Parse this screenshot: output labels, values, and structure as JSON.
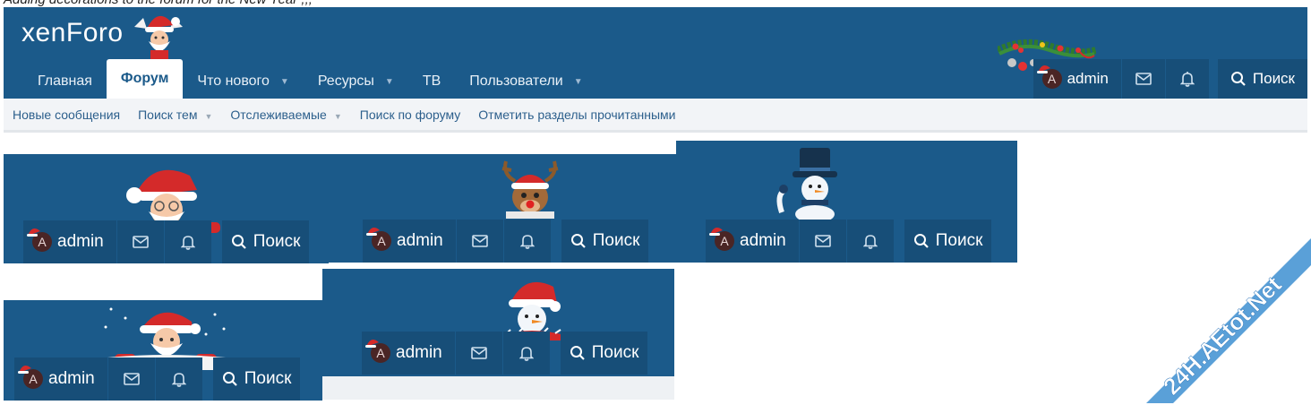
{
  "caption": "Adding decorations to the forum for the New Year ;;;",
  "logo": {
    "text": "xenForo"
  },
  "nav": {
    "tabs": [
      {
        "label": "Главная",
        "active": false,
        "dropdown": false
      },
      {
        "label": "Форум",
        "active": true,
        "dropdown": false
      },
      {
        "label": "Что нового",
        "active": false,
        "dropdown": true
      },
      {
        "label": "Ресурсы",
        "active": false,
        "dropdown": true
      },
      {
        "label": "ТВ",
        "active": false,
        "dropdown": false
      },
      {
        "label": "Пользователи",
        "active": false,
        "dropdown": true
      }
    ]
  },
  "user": {
    "name": "admin",
    "avatar_letter": "A",
    "search_label": "Поиск"
  },
  "subnav": {
    "items": [
      {
        "label": "Новые сообщения",
        "dropdown": false
      },
      {
        "label": "Поиск тем",
        "dropdown": true
      },
      {
        "label": "Отслеживаемые",
        "dropdown": true
      },
      {
        "label": "Поиск по форуму",
        "dropdown": false
      },
      {
        "label": "Отметить разделы прочитанными",
        "dropdown": false
      }
    ]
  },
  "variants": [
    {
      "mascot": "santa-peeking"
    },
    {
      "mascot": "reindeer"
    },
    {
      "mascot": "snowman-top-hat"
    },
    {
      "mascot": "santa-snowflakes"
    },
    {
      "mascot": "snowman-santa-hat"
    }
  ],
  "watermark": {
    "text": "24H.AEtot.Net"
  },
  "colors": {
    "header": "#1b5a8a",
    "button": "#174e78",
    "subnav_bg": "#f2f4f7",
    "link": "#2c5f8c"
  }
}
